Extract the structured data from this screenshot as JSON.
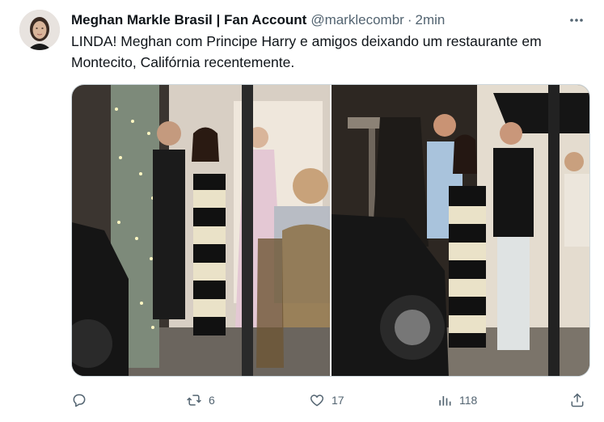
{
  "tweet": {
    "display_name": "Meghan Markle Brasil | Fan Account",
    "handle": "@marklecombr",
    "separator": "·",
    "time": "2min",
    "text": "LINDA! Meghan com Principe Harry e amigos deixando um restaurante em Montecito, Califórnia recentemente."
  },
  "actions": {
    "reply_count": "",
    "retweet_count": "6",
    "like_count": "17",
    "views_count": "118"
  },
  "colors": {
    "text": "#0f1419",
    "secondary": "#536471",
    "border": "#cfd9de"
  },
  "icons": [
    "more-icon",
    "reply-icon",
    "retweet-icon",
    "like-icon",
    "views-icon",
    "share-icon"
  ]
}
